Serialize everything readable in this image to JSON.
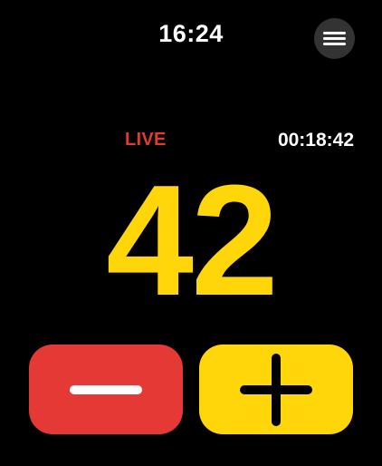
{
  "status_bar": {
    "time": "16:24"
  },
  "menu": {
    "icon": "hamburger-menu-icon"
  },
  "session": {
    "live_label": "LIVE",
    "elapsed": "00:18:42"
  },
  "counter": {
    "value": "42"
  },
  "controls": {
    "decrement_icon": "minus-icon",
    "increment_icon": "plus-icon"
  },
  "colors": {
    "background": "#000000",
    "accent_yellow": "#ffd60a",
    "live_red": "#e53935",
    "menu_button": "#333333"
  }
}
